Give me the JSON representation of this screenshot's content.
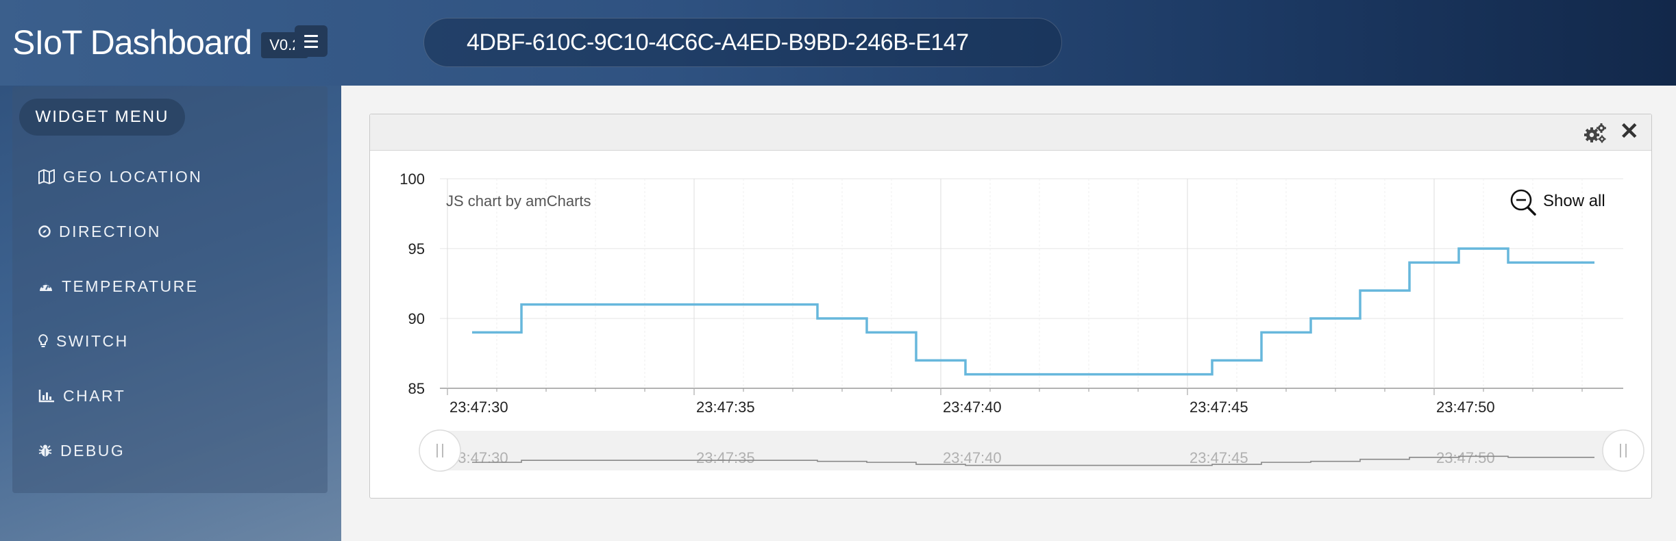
{
  "app": {
    "title": "SIoT Dashboard",
    "version": "V0.2"
  },
  "header": {
    "device_id": "4DBF-610C-9C10-4C6C-A4ED-B9BD-246B-E147"
  },
  "sidebar": {
    "menu_label": "WIDGET MENU",
    "items": [
      {
        "label": "GEO LOCATION",
        "icon": "map-icon"
      },
      {
        "label": "DIRECTION",
        "icon": "compass-icon"
      },
      {
        "label": "TEMPERATURE",
        "icon": "gauge-icon"
      },
      {
        "label": "SWITCH",
        "icon": "lightbulb-icon"
      },
      {
        "label": "CHART",
        "icon": "bar-chart-icon"
      },
      {
        "label": "DEBUG",
        "icon": "bug-icon"
      }
    ]
  },
  "widget": {
    "credit": "JS chart by amCharts",
    "show_all": "Show all"
  },
  "chart_data": {
    "type": "line",
    "step": true,
    "color": "#67b7dc",
    "x_ticks": [
      "23:47:30",
      "23:47:35",
      "23:47:40",
      "23:47:45",
      "23:47:50"
    ],
    "x": [
      "23:47:30.5",
      "23:47:31.5",
      "23:47:32.5",
      "23:47:33.5",
      "23:47:34.5",
      "23:47:35.5",
      "23:47:36.5",
      "23:47:37.5",
      "23:47:38.5",
      "23:47:39.5",
      "23:47:40.5",
      "23:47:41.5",
      "23:47:42.5",
      "23:47:43.5",
      "23:47:44.5",
      "23:47:45.5",
      "23:47:46.5",
      "23:47:47.5",
      "23:47:48.5",
      "23:47:49.5",
      "23:47:50.5",
      "23:47:51.5",
      "23:47:52.5"
    ],
    "values": [
      89,
      91,
      91,
      91,
      91,
      91,
      91,
      90,
      89,
      87,
      86,
      86,
      86,
      86,
      86,
      87,
      89,
      90,
      92,
      94,
      95,
      94,
      94
    ],
    "y_ticks": [
      85,
      90,
      95,
      100
    ],
    "ylim": [
      85,
      100
    ],
    "grid": true
  }
}
